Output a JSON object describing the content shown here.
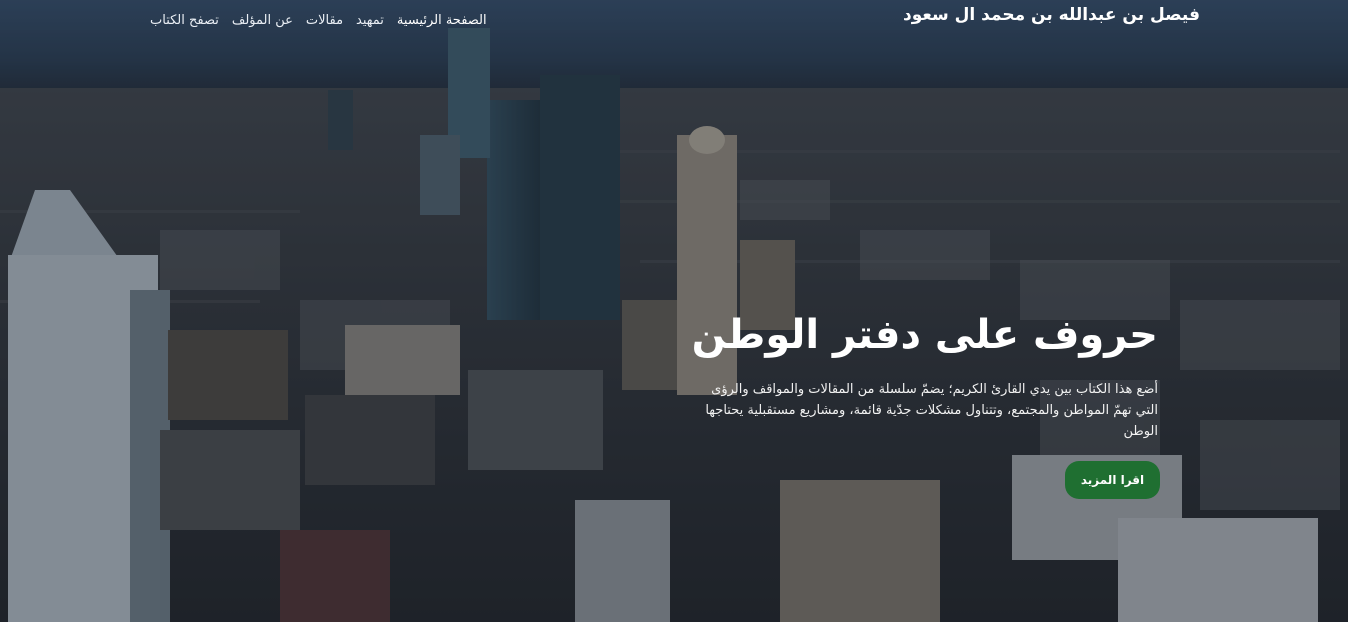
{
  "header": {
    "brand": "فيصل بن عبدالله بن محمد ال سعود",
    "nav": [
      "الصفحة الرئيسية",
      "تمهيد",
      "مقالات",
      "عن المؤلف",
      "تصفح الكتاب"
    ]
  },
  "hero": {
    "headline": "حروف على دفتر الوطن",
    "intro": "أضع هذا الكتاب بين يدي القارئ الكريم؛ يضمّ سلسلة من المقالات والمواقف والرؤى التي تهمّ المواطن والمجتمع، وتتناول مشكلات جدّية قائمة، ومشاريع مستقبلية يحتاجها الوطن",
    "cta_label": "اقرا المزيد",
    "background_image": "city-skyline-photo"
  },
  "colors": {
    "button": "#1f6f31",
    "sky": "#3f5876"
  }
}
